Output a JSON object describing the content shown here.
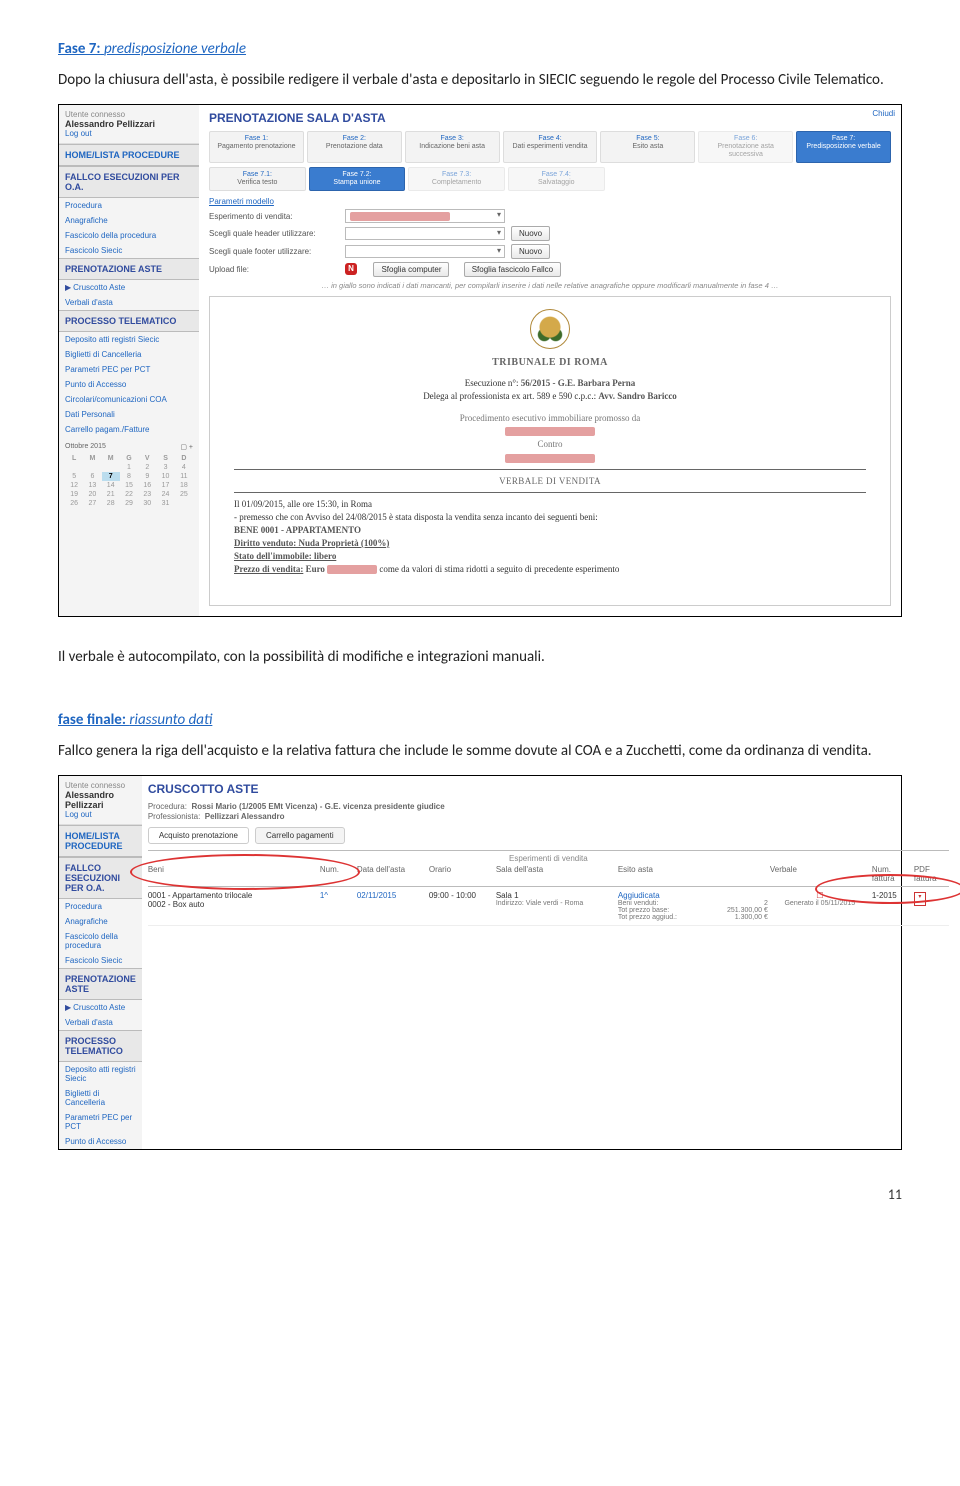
{
  "section7": {
    "heading_label": "Fase 7:",
    "heading_title": "predisposizione verbale",
    "para": "Dopo la chiusura dell'asta, è possibile redigere il verbale d'asta e depositarlo in SIECIC seguendo le regole del Processo Civile Telematico."
  },
  "shot1": {
    "user_label": "Utente connesso",
    "user_name": "Alessandro Pellizzari",
    "logout": "Log out",
    "home": "HOME/LISTA PROCEDURE",
    "fallco_hdr": "FALLCO ESECUZIONI PER O.A.",
    "nav_proc": [
      "Procedura",
      "Anagrafiche",
      "Fascicolo della procedura",
      "Fascicolo Siecic"
    ],
    "prenot_hdr": "PRENOTAZIONE ASTE",
    "cruscotto": "Cruscotto Aste",
    "verbali": "Verbali d'asta",
    "pt_hdr": "PROCESSO TELEMATICO",
    "pt_items": [
      "Deposito atti registri Siecic",
      "Biglietti di Cancelleria",
      "Parametri PEC per PCT",
      "Punto di Accesso",
      "Circolari/comunicazioni COA",
      "Dati Personali",
      "Carrello pagam./Fatture"
    ],
    "month": "Ottobre 2015",
    "title": "PRENOTAZIONE SALA D'ASTA",
    "close": "Chiudi",
    "steps": [
      {
        "n": "Fase 1:",
        "t": "Pagamento prenotazione"
      },
      {
        "n": "Fase 2:",
        "t": "Prenotazione data"
      },
      {
        "n": "Fase 3:",
        "t": "Indicazione beni asta"
      },
      {
        "n": "Fase 4:",
        "t": "Dati esperimenti vendita"
      },
      {
        "n": "Fase 5:",
        "t": "Esito asta"
      },
      {
        "n": "Fase 6:",
        "t": "Prenotazione asta successiva"
      },
      {
        "n": "Fase 7:",
        "t": "Predisposizione verbale"
      }
    ],
    "substeps": [
      {
        "n": "Fase 7.1:",
        "t": "Verifica testo"
      },
      {
        "n": "Fase 7.2:",
        "t": "Stampa unione"
      },
      {
        "n": "Fase 7.3:",
        "t": "Completamento"
      },
      {
        "n": "Fase 7.4:",
        "t": "Salvataggio"
      }
    ],
    "form": {
      "param_link": "Parametri modello",
      "esp_label": "Esperimento di vendita:",
      "header_label": "Scegli quale header utilizzare:",
      "footer_label": "Scegli quale footer utilizzare:",
      "nuovo": "Nuovo",
      "upload_label": "Upload file:",
      "upload_badge": "N",
      "btn1": "Sfoglia computer",
      "btn2": "Sfoglia fascicolo Fallco"
    },
    "hint": "… in giallo sono indicati i dati mancanti, per compilarli inserire i dati nelle relative anagrafiche oppure modificarli manualmente in fase 4 …",
    "doc": {
      "tribunale": "TRIBUNALE DI ROMA",
      "esec_pref": "Esecuzione n°:",
      "esec_val": "56/2015 - G.E. Barbara Perna",
      "delega": "Delega al professionista ex art. 589 e 590 c.p.c.:",
      "delega_val": "Avv. Sandro Baricco",
      "proc": "Procedimento esecutivo immobiliare promosso da",
      "contro": "Contro",
      "vv_title": "VERBALE DI VENDITA",
      "time": "Il 01/09/2015, alle ore 15:30, in Roma",
      "prem": "- premesso che con Avviso del 24/08/2015 è stata disposta la vendita senza incanto dei seguenti beni:",
      "bene": "BENE 0001 - APPARTAMENTO",
      "diritto": "Diritto venduto: Nuda Proprietà (100%)",
      "stato": "Stato dell'immobile: libero",
      "prezzo_pref": "Prezzo di vendita:",
      "prezzo_euro": "Euro",
      "prezzo_suf": "come da valori di stima ridotti a seguito di precedente esperimento"
    }
  },
  "mid_para": "Il verbale è autocompilato, con la possibilità di modifiche e integrazioni manuali.",
  "final": {
    "heading_label": "fase finale:",
    "heading_title": "riassunto dati",
    "para": "Fallco genera la riga dell'acquisto e la relativa fattura che include le somme dovute al COA e a Zucchetti, come da ordinanza di vendita."
  },
  "shot2": {
    "title": "CRUSCOTTO ASTE",
    "proc_label": "Procedura:",
    "proc_val": "Rossi Mario (1/2005 EMt Vicenza) - G.E. vicenza presidente giudice",
    "prof_label": "Professionista:",
    "prof_val": "Pellizzari Alessandro",
    "tab1": "Acquisto prenotazione",
    "tab2": "Carrello pagamenti",
    "col_beni": "Beni",
    "grp_esp": "Esperimenti di vendita",
    "col_num": "Num.",
    "col_data": "Data dell'asta",
    "col_orario": "Orario",
    "col_sala": "Sala dell'asta",
    "col_esito": "Esito asta",
    "col_verbale": "Verbale",
    "col_nf": "Num. fattura",
    "col_pdf": "PDF fattura",
    "row": {
      "beni1": "0001 - Appartamento trilocale",
      "beni2": "0002 - Box auto",
      "num": "1^",
      "data": "02/11/2015",
      "orario": "09:00 - 10:00",
      "sala1": "Sala 1",
      "sala2": "Indirizzo: Viale verdi - Roma",
      "esito_t": "Aggiudicata",
      "esito_l1": "Beni venduti:",
      "esito_l2": "Tot prezzo base:",
      "esito_l3": "Tot prezzo aggiud.:",
      "esito_v1": "2",
      "esito_v2": "251.300,00 €",
      "esito_v3": "1.300,00 €",
      "verbale": "Generato il 05/11/2015",
      "nf": "1-2015"
    }
  },
  "page_number": "11"
}
